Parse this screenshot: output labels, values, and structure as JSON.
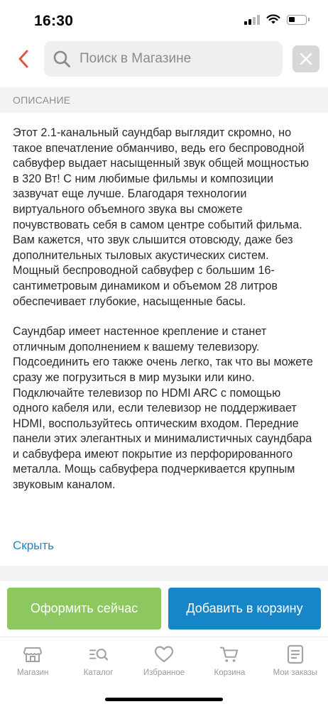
{
  "status_bar": {
    "time": "16:30",
    "icons": [
      "cellular-signal-icon",
      "wifi-icon",
      "battery-icon"
    ]
  },
  "header": {
    "back_icon": "chevron-left-icon",
    "search_icon": "search-icon",
    "search_placeholder": "Поиск в Магазине",
    "close_icon": "close-icon"
  },
  "section": {
    "label": "ОПИСАНИЕ"
  },
  "description": {
    "paragraphs": [
      "Этот 2.1-канальный саундбар выглядит скромно, но такое впечатление обманчиво, ведь его беспроводной сабвуфер выдает насыщенный звук общей мощностью в 320 Вт! С ним любимые фильмы и композиции зазвучат еще лучше. Благодаря технологии виртуального объемного звука вы сможете почувствовать себя в самом центре событий фильма. Вам кажется, что звук слышится отовсюду, даже без дополнительных тыловых акустических систем. Мощный беспроводной сабвуфер с большим 16-сантиметровым динамиком и объемом 28 литров обеспечивает глубокие, насыщенные басы.",
      "Саундбар имеет настенное крепление и станет отличным дополнением к вашему телевизору. Подсоединить его также очень легко, так что вы можете сразу же погрузиться в мир музыки или кино. Подключайте телевизор по HDMI ARC с помощью одного кабеля или, если телевизор не поддерживает HDMI, воспользуйтесь оптическим входом. Передние панели этих элегантных и минималистичных саундбара и сабвуфера имеют покрытие из перфорированного металла. Мощь сабвуфера подчеркивается крупным звуковым каналом."
    ],
    "hide_label": "Скрыть"
  },
  "actions": {
    "checkout_label": "Оформить сейчас",
    "add_to_cart_label": "Добавить в корзину"
  },
  "bottom_nav": {
    "items": [
      {
        "label": "Магазин",
        "icon": "store-icon"
      },
      {
        "label": "Каталог",
        "icon": "catalog-search-icon"
      },
      {
        "label": "Избранное",
        "icon": "heart-icon"
      },
      {
        "label": "Корзина",
        "icon": "cart-icon"
      },
      {
        "label": "Мои заказы",
        "icon": "orders-icon"
      }
    ]
  },
  "colors": {
    "accent_red": "#e4553f",
    "link_blue": "#1e88c8",
    "checkout_green": "#8dc75f",
    "cart_blue": "#1686c9",
    "nav_gray": "#9a9a9a"
  }
}
